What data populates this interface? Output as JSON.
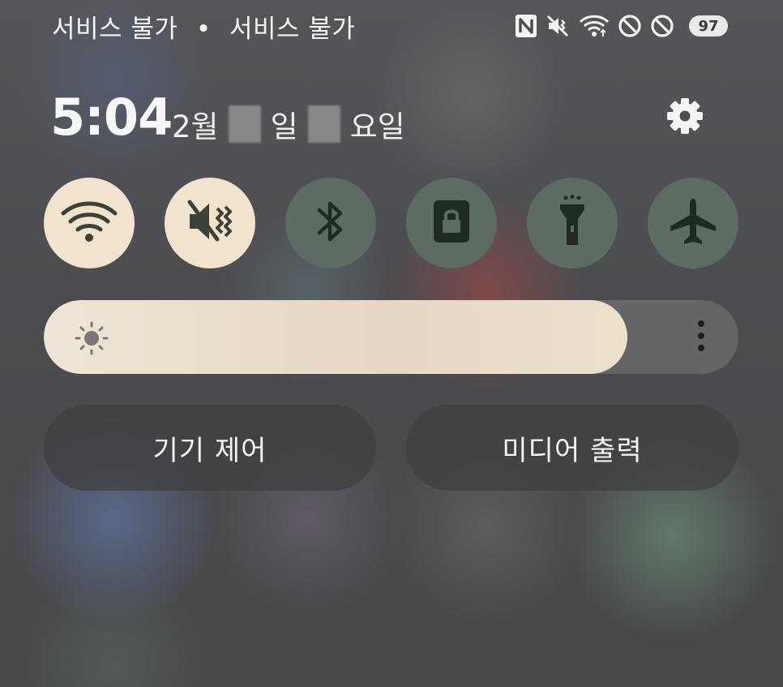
{
  "status_bar": {
    "carrier_left": "서비스 불가",
    "separator": "•",
    "carrier_right": "서비스 불가",
    "icons": [
      "nfc-icon",
      "vibrate-mute-icon",
      "wifi-signal-icon",
      "do-not-disturb-icon",
      "do-not-disturb-icon"
    ],
    "battery_level": "97"
  },
  "header": {
    "time": "5:04",
    "date_month": "2월",
    "date_day_suffix": "일",
    "date_weekday_suffix": "요일",
    "settings_icon": "gear-icon"
  },
  "quick_toggles": [
    {
      "name": "wifi",
      "icon": "wifi-icon",
      "state": "on"
    },
    {
      "name": "mute",
      "icon": "mute-icon",
      "state": "on"
    },
    {
      "name": "bluetooth",
      "icon": "bluetooth-icon",
      "state": "off"
    },
    {
      "name": "screen-lock",
      "icon": "lock-icon",
      "state": "off"
    },
    {
      "name": "flashlight",
      "icon": "flashlight-icon",
      "state": "off"
    },
    {
      "name": "airplane",
      "icon": "airplane-icon",
      "state": "off"
    }
  ],
  "brightness": {
    "level": 0.84,
    "icon": "sun-icon",
    "more_icon": "more-vertical-icon"
  },
  "panels": {
    "device_control": "기기 제어",
    "media_output": "미디어 출력"
  },
  "colors": {
    "toggle_on": "#f2e3cf",
    "toggle_off": "#5d6c62",
    "icon_on": "#3a4239",
    "icon_off": "#1f2a23"
  }
}
